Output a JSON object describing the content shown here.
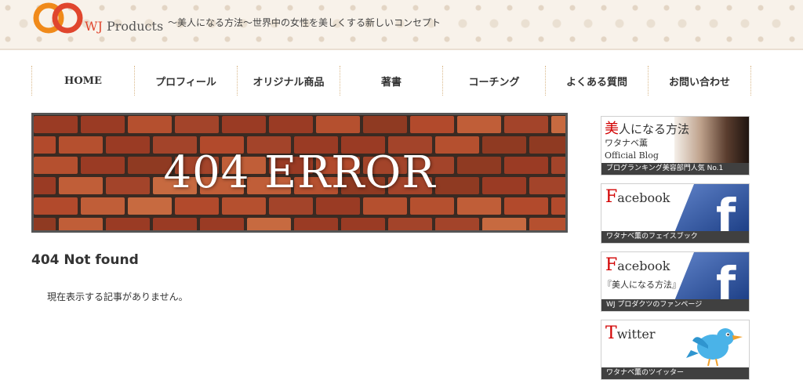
{
  "header": {
    "brand_prefix": "WJ",
    "brand_suffix": "Products",
    "tagline": "〜美人になる方法〜世界中の女性を美しくする新しいコンセプト"
  },
  "nav": {
    "items": [
      {
        "label": "HOME"
      },
      {
        "label": "プロフィール"
      },
      {
        "label": "オリジナル商品"
      },
      {
        "label": "著書"
      },
      {
        "label": "コーチング"
      },
      {
        "label": "よくある質問"
      },
      {
        "label": "お問い合わせ"
      }
    ]
  },
  "hero": {
    "text": "404 ERROR"
  },
  "main": {
    "title": "404 Not found",
    "message": "現在表示する記事がありません。"
  },
  "sidebar": {
    "blog": {
      "title_first": "美",
      "title_rest": "人になる方法",
      "author": "ワタナベ薫",
      "subtitle": "Official Blog",
      "caption": "ブログランキング美容部門人気 No.1"
    },
    "facebook1": {
      "title_first": "F",
      "title_rest": "acebook",
      "caption": "ワタナベ薫のフェイスブック"
    },
    "facebook2": {
      "title_first": "F",
      "title_rest": "acebook",
      "sub": "『美人になる方法』",
      "caption": "WJ プロダクツのファンページ"
    },
    "twitter": {
      "title_first": "T",
      "title_rest": "witter",
      "caption": "ワタナベ薫のツイッター"
    }
  },
  "colors": {
    "accent_red": "#d20000",
    "facebook_blue": "#2f57a6",
    "twitter_blue": "#4ab3e8",
    "banner_border": "#555555"
  },
  "icons": [
    "wj-logo-icon",
    "facebook-f-icon",
    "twitter-bird-icon"
  ]
}
